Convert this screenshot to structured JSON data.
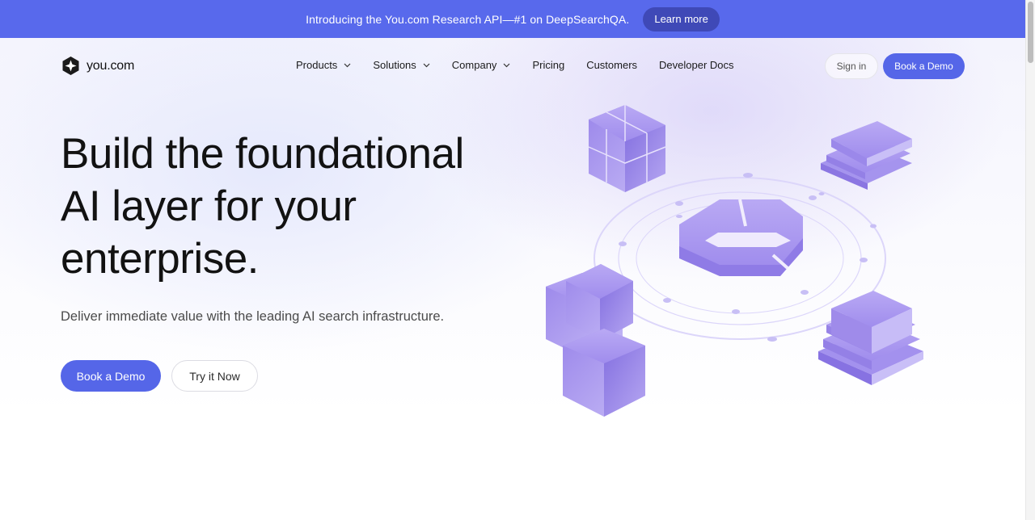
{
  "promo": {
    "text": "Introducing the You.com Research API—#1 on DeepSearchQA.",
    "button_label": "Learn more"
  },
  "nav": {
    "logo_text": "you.com",
    "items": [
      {
        "label": "Products",
        "dropdown": true
      },
      {
        "label": "Solutions",
        "dropdown": true
      },
      {
        "label": "Company",
        "dropdown": true
      },
      {
        "label": "Pricing",
        "dropdown": false
      },
      {
        "label": "Customers",
        "dropdown": false
      },
      {
        "label": "Developer Docs",
        "dropdown": false
      }
    ],
    "sign_in_label": "Sign in",
    "book_demo_label": "Book a Demo"
  },
  "hero": {
    "headline_lines": [
      "Build the foundational",
      "AI layer for your",
      "enterprise."
    ],
    "subheadline": "Deliver immediate value with the leading AI search infrastructure.",
    "primary_cta": "Book a Demo",
    "secondary_cta": "Try it Now"
  },
  "colors": {
    "accent": "#5566e8",
    "promo_bar": "#5869ec",
    "promo_button": "#3f49b7",
    "illustration_purple": "#9a86ea"
  },
  "icons": {
    "logo": "you-com-logo-icon",
    "dropdown": "chevron-down-icon"
  }
}
